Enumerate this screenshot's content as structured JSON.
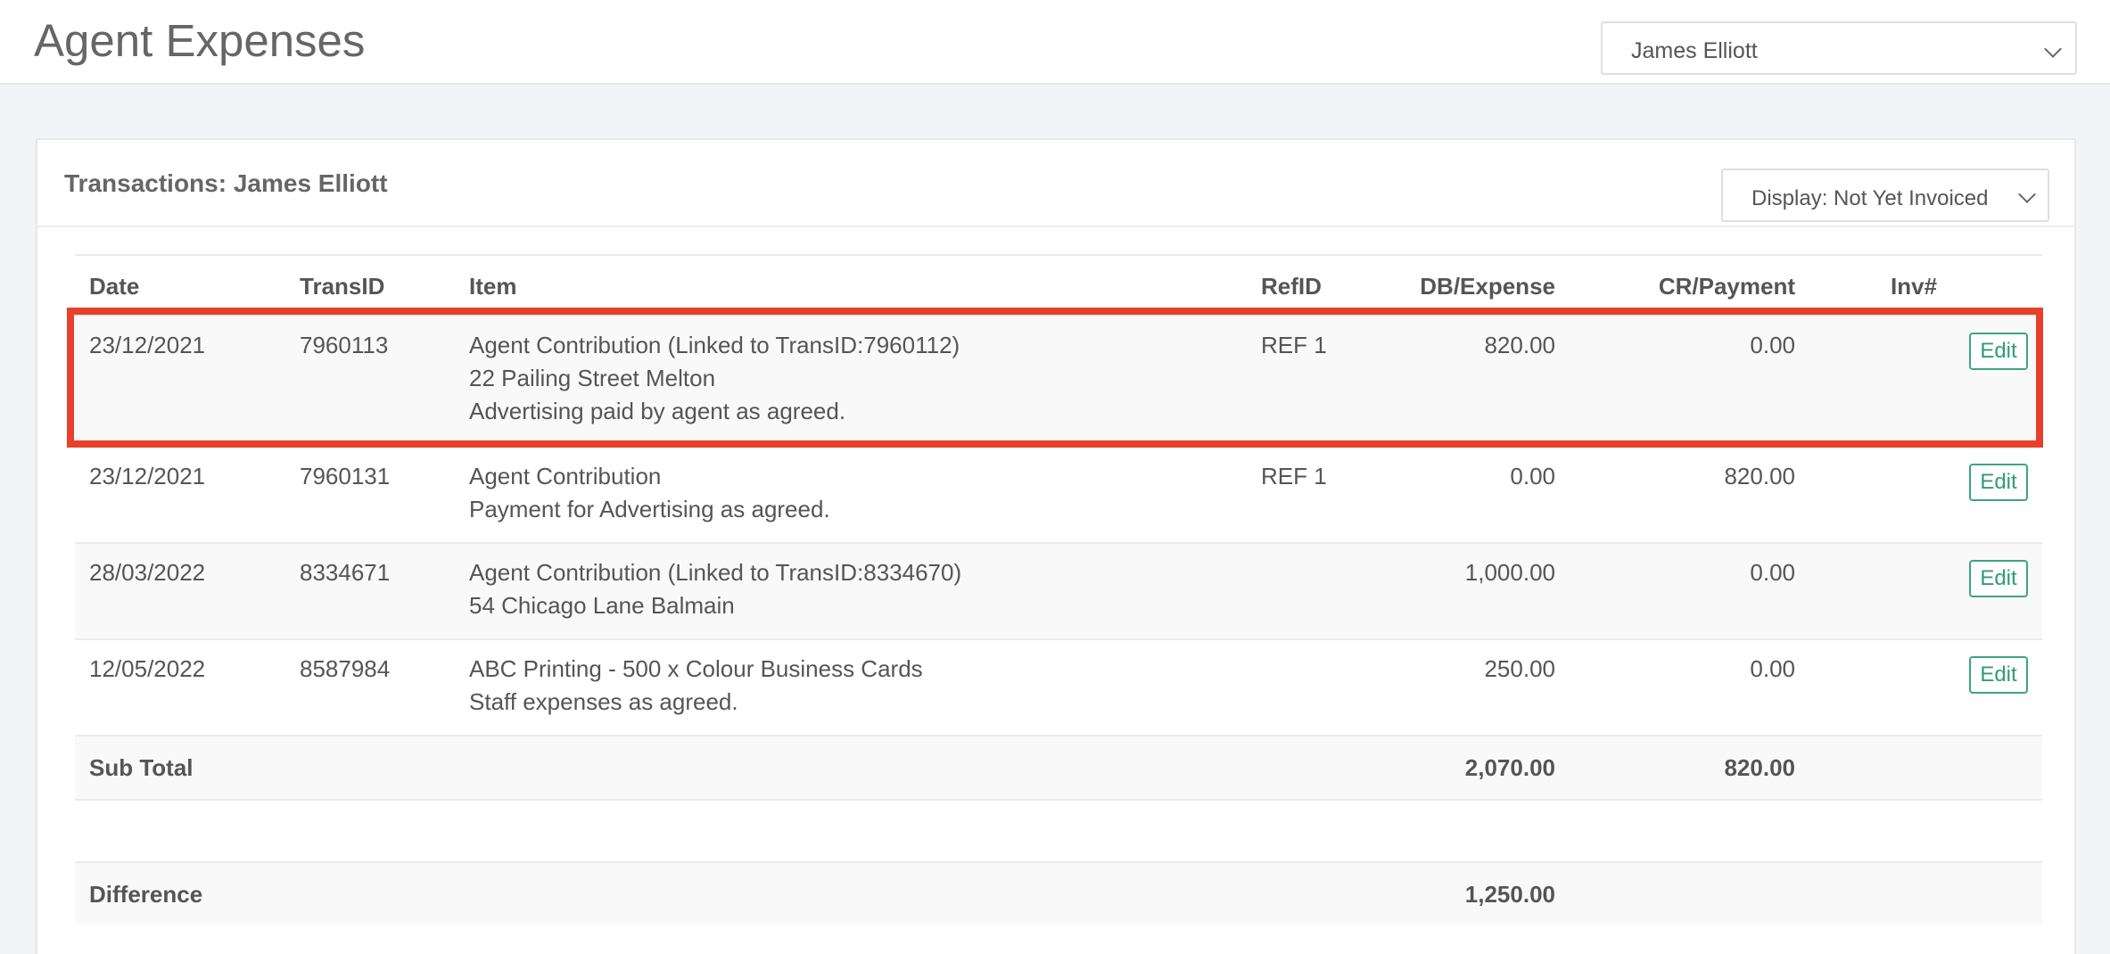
{
  "page": {
    "title": "Agent Expenses"
  },
  "agent_select": {
    "value": "James Elliott"
  },
  "panel": {
    "title": "Transactions: James Elliott",
    "display_select": {
      "value": "Display: Not Yet Invoiced"
    }
  },
  "table": {
    "headers": {
      "date": "Date",
      "transid": "TransID",
      "item": "Item",
      "refid": "RefID",
      "db": "DB/Expense",
      "cr": "CR/Payment",
      "inv": "Inv#"
    },
    "rows": [
      {
        "date": "23/12/2021",
        "transid": "7960113",
        "item": [
          "Agent Contribution (Linked to TransID:7960112)",
          "22 Pailing Street Melton",
          "Advertising paid by agent as agreed."
        ],
        "refid": "REF 1",
        "db": "820.00",
        "cr": "0.00",
        "inv": "",
        "edit": "Edit",
        "highlighted": true
      },
      {
        "date": "23/12/2021",
        "transid": "7960131",
        "item": [
          "Agent Contribution",
          "Payment for Advertising as agreed."
        ],
        "refid": "REF 1",
        "db": "0.00",
        "cr": "820.00",
        "inv": "",
        "edit": "Edit"
      },
      {
        "date": "28/03/2022",
        "transid": "8334671",
        "item": [
          "Agent Contribution (Linked to TransID:8334670)",
          "54 Chicago Lane Balmain"
        ],
        "refid": "",
        "db": "1,000.00",
        "cr": "0.00",
        "inv": "",
        "edit": "Edit"
      },
      {
        "date": "12/05/2022",
        "transid": "8587984",
        "item": [
          "ABC Printing - 500 x Colour Business Cards",
          "Staff expenses as agreed."
        ],
        "refid": "",
        "db": "250.00",
        "cr": "0.00",
        "inv": "",
        "edit": "Edit"
      }
    ],
    "subtotal": {
      "label": "Sub Total",
      "db": "2,070.00",
      "cr": "820.00"
    },
    "difference": {
      "label": "Difference",
      "db": "1,250.00"
    }
  },
  "colors": {
    "highlight": "#e8402a",
    "edit_accent": "#3aa681"
  },
  "icons": {
    "select_arrow": "chevron-down-icon"
  }
}
